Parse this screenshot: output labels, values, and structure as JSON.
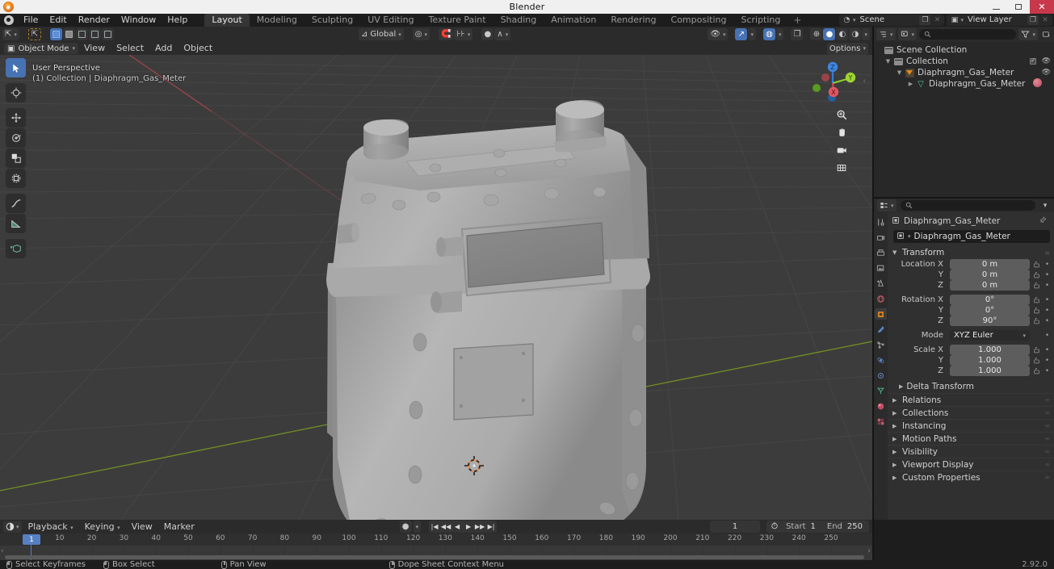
{
  "window": {
    "title": "Blender",
    "minimize": "minimize",
    "maximize": "maximize",
    "close": "close"
  },
  "topbar": {
    "app_icon": "blender-logo-icon",
    "menus": [
      "File",
      "Edit",
      "Render",
      "Window",
      "Help"
    ],
    "workspaces": [
      {
        "label": "Layout",
        "active": true
      },
      {
        "label": "Modeling",
        "active": false
      },
      {
        "label": "Sculpting",
        "active": false
      },
      {
        "label": "UV Editing",
        "active": false
      },
      {
        "label": "Texture Paint",
        "active": false
      },
      {
        "label": "Shading",
        "active": false
      },
      {
        "label": "Animation",
        "active": false
      },
      {
        "label": "Rendering",
        "active": false
      },
      {
        "label": "Compositing",
        "active": false
      },
      {
        "label": "Scripting",
        "active": false
      }
    ],
    "add_workspace": "+",
    "scene": {
      "label": "Scene",
      "new_btn": "new-scene",
      "unlink_btn": "unlink-scene"
    },
    "view_layer": {
      "label": "View Layer",
      "new_btn": "new-view-layer",
      "remove_btn": "remove-view-layer"
    }
  },
  "viewport_header": {
    "editor_type": "3d-viewport",
    "mode": "Object Mode",
    "menus": [
      "View",
      "Select",
      "Add",
      "Object"
    ],
    "transform_orientation": "Global",
    "snap": "snap-magnet",
    "proportional_edit": "proportional-editing",
    "overlay_label": "Options"
  },
  "viewport": {
    "perspective": "User Perspective",
    "collection_info": "(1) Collection | Diaphragm_Gas_Meter",
    "gizmo_axes": [
      {
        "label": "Z",
        "color": "#2e7ed6"
      },
      {
        "label": "Y",
        "color": "#8fce28"
      },
      {
        "label": "X",
        "color": "#d6454f"
      }
    ],
    "nav_buttons": [
      "zoom-icon",
      "pan-hand-icon",
      "camera-icon",
      "grid-ortho-icon"
    ],
    "tools": [
      {
        "name": "tweak-select-box",
        "active": true
      },
      {
        "name": "cursor-tool",
        "active": false
      },
      {
        "name": "move-tool",
        "active": false
      },
      {
        "name": "rotate-tool",
        "active": false
      },
      {
        "name": "scale-tool",
        "active": false
      },
      {
        "name": "transform-tool",
        "active": false
      },
      {
        "name": "annotate-tool",
        "active": false
      },
      {
        "name": "measure-tool",
        "active": false
      },
      {
        "name": "add-cube-tool",
        "active": false
      }
    ],
    "background_color": "#3c3c3c",
    "object_color": "#a8a8a8",
    "axis_x_color": "#a83f48",
    "axis_y_color": "#7a9b2c"
  },
  "outliner": {
    "header": {
      "editor_icon": "outliner-icon",
      "display_mode": "View Layer",
      "search_placeholder": "",
      "filter_icon": "filter-icon",
      "new_collection_icon": "new-collection-icon"
    },
    "rows": [
      {
        "label": "Scene Collection",
        "depth": 0,
        "icon": "scene-collection-icon",
        "expanded": null,
        "checkbox": false,
        "eye": false
      },
      {
        "label": "Collection",
        "depth": 1,
        "icon": "collection-icon",
        "expanded": true,
        "checkbox": true,
        "eye": true
      },
      {
        "label": "Diaphragm_Gas_Meter",
        "depth": 2,
        "icon": "object-icon",
        "expanded": true,
        "checkbox": false,
        "eye": true
      },
      {
        "label": "Diaphragm_Gas_Meter",
        "depth": 3,
        "icon": "mesh-data-icon",
        "expanded": false,
        "checkbox": false,
        "eye": false,
        "material": true
      }
    ]
  },
  "properties": {
    "header": {
      "editor_icon": "properties-icon",
      "search_placeholder": "",
      "dropdown": "chevron-down-icon"
    },
    "tabs": [
      {
        "name": "tool-tab",
        "icon": "tool-icon",
        "active": false
      },
      {
        "name": "render-tab",
        "icon": "render-camera-icon",
        "active": false
      },
      {
        "name": "output-tab",
        "icon": "output-printer-icon",
        "active": false
      },
      {
        "name": "view-layer-tab",
        "icon": "view-layer-images-icon",
        "active": false
      },
      {
        "name": "scene-tab",
        "icon": "scene-cone-icon",
        "active": false
      },
      {
        "name": "world-tab",
        "icon": "world-globe-icon",
        "active": false
      },
      {
        "name": "object-tab",
        "icon": "object-square-icon",
        "active": true
      },
      {
        "name": "modifier-tab",
        "icon": "wrench-icon",
        "active": false
      },
      {
        "name": "particles-tab",
        "icon": "particles-icon",
        "active": false
      },
      {
        "name": "physics-tab",
        "icon": "physics-orbit-icon",
        "active": false
      },
      {
        "name": "constraints-tab",
        "icon": "constraint-icon",
        "active": false
      },
      {
        "name": "data-tab",
        "icon": "mesh-data-green-icon",
        "active": false
      },
      {
        "name": "material-tab",
        "icon": "material-sphere-icon",
        "active": false
      },
      {
        "name": "texture-tab",
        "icon": "texture-checker-icon",
        "active": false
      }
    ],
    "breadcrumb": "Diaphragm_Gas_Meter",
    "pin_icon": "pin-icon",
    "object_name": "Diaphragm_Gas_Meter",
    "transform_panel": {
      "title": "Transform",
      "expanded": true,
      "rows": [
        {
          "label": "Location X",
          "value": "0 m",
          "type": "number"
        },
        {
          "label": "Y",
          "value": "0 m",
          "type": "number"
        },
        {
          "label": "Z",
          "value": "0 m",
          "type": "number"
        },
        {
          "label": "Rotation X",
          "value": "0°",
          "type": "number",
          "gap": true
        },
        {
          "label": "Y",
          "value": "0°",
          "type": "number"
        },
        {
          "label": "Z",
          "value": "90°",
          "type": "number"
        },
        {
          "label": "Mode",
          "value": "XYZ Euler",
          "type": "select",
          "gap": true
        },
        {
          "label": "Scale X",
          "value": "1.000",
          "type": "number",
          "gap": true
        },
        {
          "label": "Y",
          "value": "1.000",
          "type": "number"
        },
        {
          "label": "Z",
          "value": "1.000",
          "type": "number"
        }
      ],
      "sub_panel": "Delta Transform"
    },
    "closed_panels": [
      "Relations",
      "Collections",
      "Instancing",
      "Motion Paths",
      "Visibility",
      "Viewport Display",
      "Custom Properties"
    ]
  },
  "timeline": {
    "editor_icon": "timeline-clock-icon",
    "menus": [
      "Playback",
      "Keying",
      "View",
      "Marker"
    ],
    "auto_key_icon": "record-dot-icon",
    "playback_buttons": [
      "jump-start",
      "prev-keyframe",
      "play-reverse",
      "play",
      "next-keyframe",
      "jump-end"
    ],
    "current_frame": "1",
    "start_label": "Start",
    "start_value": "1",
    "end_label": "End",
    "end_value": "250",
    "ticks": [
      "1",
      "10",
      "20",
      "30",
      "40",
      "50",
      "60",
      "70",
      "80",
      "90",
      "100",
      "110",
      "120",
      "130",
      "140",
      "150",
      "160",
      "170",
      "180",
      "190",
      "200",
      "210",
      "220",
      "230",
      "240",
      "250"
    ]
  },
  "statusbar": {
    "items": [
      {
        "mouse": "left",
        "label": "Select Keyframes"
      },
      {
        "mouse": "middle",
        "label": "Box Select"
      },
      {
        "mouse": "middle2",
        "label": "Pan View"
      },
      {
        "mouse": "right",
        "label": "Dope Sheet Context Menu"
      }
    ],
    "version": "2.92.0"
  }
}
